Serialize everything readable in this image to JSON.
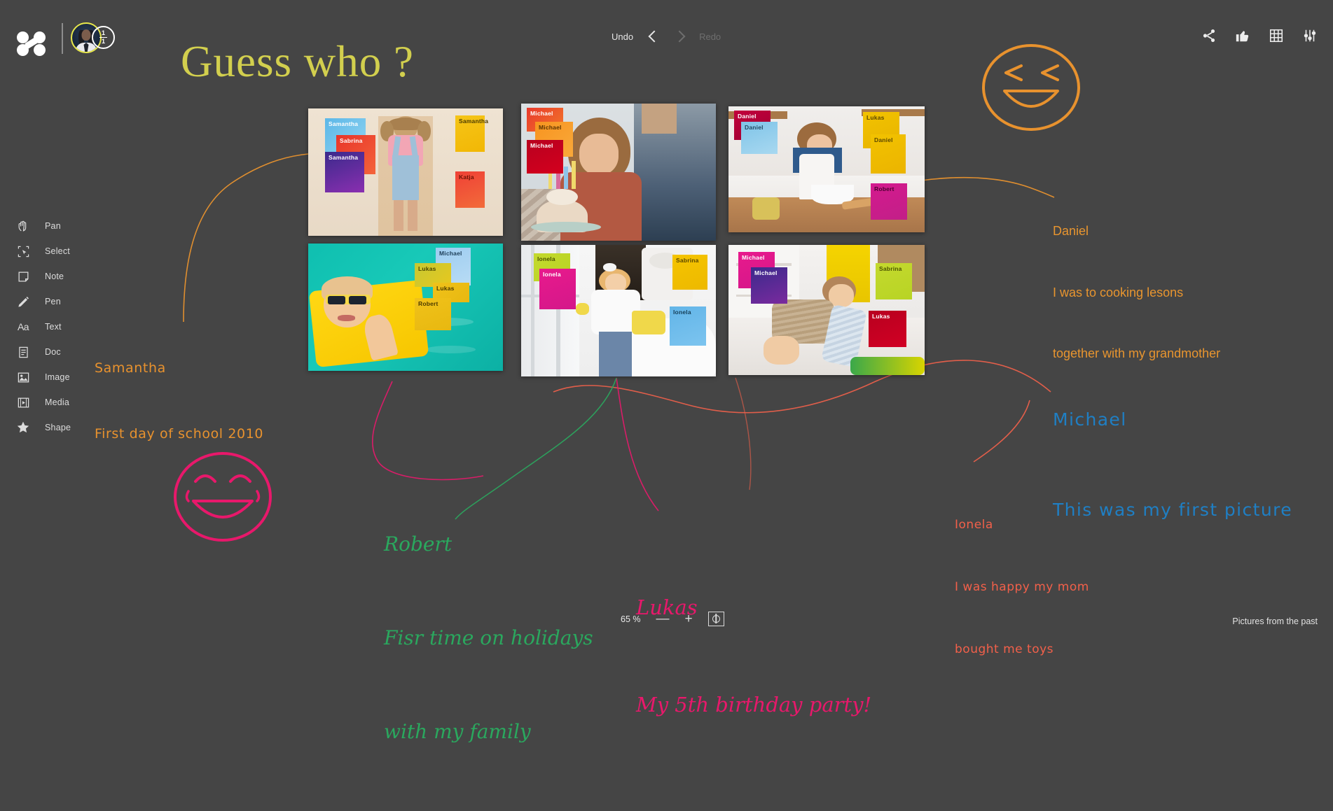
{
  "app": {
    "background_color": "#454545",
    "board_name": "Pictures from the past"
  },
  "topbar": {
    "logo_name": "app-logo",
    "page_indicator": {
      "current": "1",
      "total": "1"
    },
    "history": {
      "undo_label": "Undo",
      "redo_label": "Redo"
    },
    "right_icons": [
      {
        "name": "share-icon",
        "label": "Share"
      },
      {
        "name": "thumbs-up-icon",
        "label": "Like"
      },
      {
        "name": "grid-icon",
        "label": "Grid"
      },
      {
        "name": "settings-sliders-icon",
        "label": "Settings"
      }
    ]
  },
  "sidebar": {
    "items": [
      {
        "label": "Pan",
        "icon": "pan-hand-icon"
      },
      {
        "label": "Select",
        "icon": "select-marquee-icon"
      },
      {
        "label": "Note",
        "icon": "sticky-note-icon"
      },
      {
        "label": "Pen",
        "icon": "pen-icon"
      },
      {
        "label": "Text",
        "icon": "text-aa-icon"
      },
      {
        "label": "Doc",
        "icon": "document-icon"
      },
      {
        "label": "Image",
        "icon": "image-icon"
      },
      {
        "label": "Media",
        "icon": "media-film-icon"
      },
      {
        "label": "Shape",
        "icon": "star-shape-icon"
      }
    ]
  },
  "canvas": {
    "title": "Guess who ?",
    "photos": [
      {
        "id": "photo-girl-pigtails",
        "alt": "Girl with pigtails in pink shirt and denim overalls",
        "notes": [
          {
            "text": "Samantha",
            "color": "#5bb7e8",
            "color2": "#8fd3f0",
            "fg": "#ffffff"
          },
          {
            "text": "Sabrina",
            "color": "#e8352a",
            "color2": "#f4633a",
            "fg": "#ffffff"
          },
          {
            "text": "Samantha",
            "color": "#3b2a8c",
            "color2": "#8a2fb0",
            "fg": "#ffffff"
          },
          {
            "text": "Samantha",
            "color": "#f5c518",
            "color2": "#f2b705",
            "fg": "#4a3a00"
          },
          {
            "text": "Katja",
            "color": "#ef4136",
            "color2": "#f26b3a",
            "fg": "#6b1205"
          }
        ]
      },
      {
        "id": "photo-boy-candles",
        "alt": "Boy blowing out birthday candles on a cupcake",
        "notes": [
          {
            "text": "Michael",
            "color": "#e8392c",
            "color2": "#f2762a",
            "fg": "#ffffff"
          },
          {
            "text": "Michael",
            "color": "#f79420",
            "color2": "#f9a93a",
            "fg": "#5a3200"
          },
          {
            "text": "Michael",
            "color": "#b8001f",
            "color2": "#d4001e",
            "fg": "#ffffff"
          }
        ]
      },
      {
        "id": "photo-boy-baking",
        "alt": "Boy baking in a kitchen with a mixing bowl",
        "notes": [
          {
            "text": "Daniel",
            "color": "#c2003c",
            "color2": "#9e0030",
            "fg": "#ffffff"
          },
          {
            "text": "Daniel",
            "color": "#7fc4e8",
            "color2": "#a8d8f0",
            "fg": "#1f4a63"
          },
          {
            "text": "Lukas",
            "color": "#f2c200",
            "color2": "#e8b400",
            "fg": "#5a4600"
          },
          {
            "text": "Daniel",
            "color": "#f2c200",
            "color2": "#ebb400",
            "fg": "#5a4600"
          },
          {
            "text": "Robert",
            "color": "#d41a8e",
            "color2": "#c21f88",
            "fg": "#4a0030"
          }
        ]
      },
      {
        "id": "photo-baby-pool",
        "alt": "Baby with sunglasses on a yellow float in a turquoise pool",
        "notes": [
          {
            "text": "Michael",
            "color": "#9ecdf0",
            "color2": "#b8dcf5",
            "fg": "#1e3f59"
          },
          {
            "text": "Lukas",
            "color": "#c6c832",
            "color2": "#e8c81e",
            "fg": "#4a4700"
          },
          {
            "text": "Lukas",
            "color": "#f0c21a",
            "color2": "#e8b810",
            "fg": "#4a3a00"
          },
          {
            "text": "Robert",
            "color": "#f0c21a",
            "color2": "#e8b810",
            "fg": "#4a3a00"
          }
        ]
      },
      {
        "id": "photo-girl-wateringcan",
        "alt": "Girl holding a yellow watering can by a bright window",
        "notes": [
          {
            "text": "Ionela",
            "color": "#c4d92e",
            "color2": "#b8d424",
            "fg": "#4a5200"
          },
          {
            "text": "Ionela",
            "color": "#e81a8c",
            "color2": "#d4178a",
            "fg": "#ffffff"
          },
          {
            "text": "Sabrina",
            "color": "#f5c400",
            "color2": "#edb900",
            "fg": "#5a4600"
          },
          {
            "text": "Ionela",
            "color": "#62b5e8",
            "color2": "#7cc4ef",
            "fg": "#153e57"
          }
        ]
      },
      {
        "id": "photo-baby-crawling",
        "alt": "Baby crawling on a white floor in a nursery",
        "notes": [
          {
            "text": "Michael",
            "color": "#e81a8c",
            "color2": "#d4178a",
            "fg": "#ffffff"
          },
          {
            "text": "Michael",
            "color": "#3b2a8c",
            "color2": "#7a2a9e",
            "fg": "#ffffff"
          },
          {
            "text": "Sabrina",
            "color": "#c4d92e",
            "color2": "#b8d424",
            "fg": "#4a5200"
          },
          {
            "text": "Lukas",
            "color": "#b8001f",
            "color2": "#d10024",
            "fg": "#ffffff"
          }
        ]
      }
    ],
    "captions": [
      {
        "id": "caption-samantha",
        "name": "Samantha",
        "lines": [
          "Samantha",
          "First day of school 2010"
        ],
        "color": "#e8922e"
      },
      {
        "id": "caption-daniel",
        "name": "Daniel",
        "lines": [
          "Daniel",
          "I was to cooking lesons",
          "together with my grandmother"
        ],
        "color": "#e8952f"
      },
      {
        "id": "caption-michael",
        "name": "Michael",
        "lines": [
          "Michael",
          "This was my first picture"
        ],
        "color": "#1f7fc4"
      },
      {
        "id": "caption-robert",
        "name": "Robert",
        "lines": [
          "Robert",
          "Fisr time on holidays",
          "with my family"
        ],
        "color": "#2aa85e"
      },
      {
        "id": "caption-lukas",
        "name": "Lukas",
        "lines": [
          "Lukas",
          "My 5th birthday party!"
        ],
        "color": "#e8186b"
      },
      {
        "id": "caption-ionela",
        "name": "Ionela",
        "lines": [
          "Ionela",
          "I was happy my mom",
          "bought me toys"
        ],
        "color": "#f2604a"
      }
    ],
    "stickers": [
      {
        "name": "winking-laugh-emoji",
        "color": "#e8922e"
      },
      {
        "name": "happy-tears-emoji",
        "color": "#e8186b"
      }
    ]
  },
  "zoom": {
    "level": "65 %",
    "zoom_out_label": "—",
    "zoom_in_label": "+",
    "fit_label": "Fit to screen"
  }
}
